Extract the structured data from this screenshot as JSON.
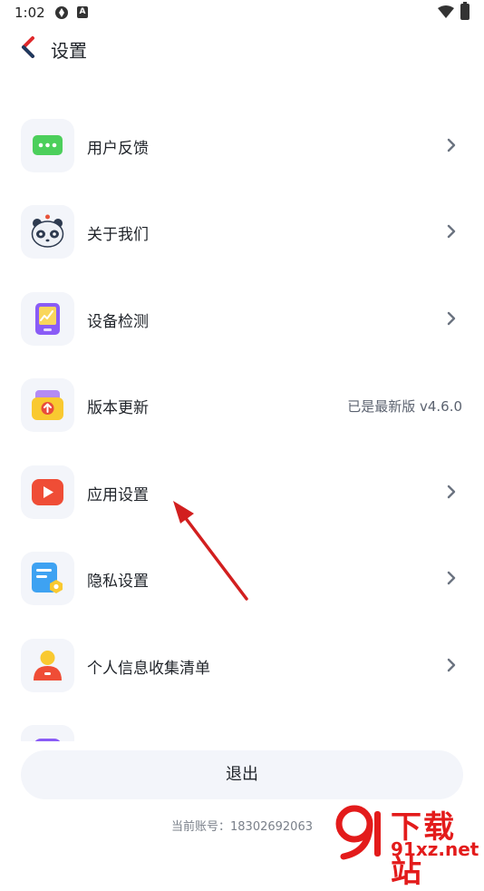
{
  "status_bar": {
    "time": "1:02",
    "icon_a": "A"
  },
  "header": {
    "title": "设置",
    "back_icon": "chevron-left-icon"
  },
  "items": [
    {
      "label": "用户反馈",
      "icon": "chat-bubble-icon"
    },
    {
      "label": "关于我们",
      "icon": "panda-icon"
    },
    {
      "label": "设备检测",
      "icon": "tablet-chart-icon"
    },
    {
      "label": "版本更新",
      "icon": "upload-box-icon",
      "value": "已是最新版 v4.6.0"
    },
    {
      "label": "应用设置",
      "icon": "play-icon"
    },
    {
      "label": "隐私设置",
      "icon": "document-shield-icon"
    },
    {
      "label": "个人信息收集清单",
      "icon": "person-icon"
    }
  ],
  "logout": {
    "label": "退出"
  },
  "account": {
    "prefix": "当前账号：",
    "number": "18302692063"
  },
  "watermark": {
    "title": "下载站",
    "site": "91xz.net"
  },
  "colors": {
    "accent_red": "#e0292c",
    "chevron": "#6b7380",
    "row_icon_bg": "#f3f5fa"
  }
}
